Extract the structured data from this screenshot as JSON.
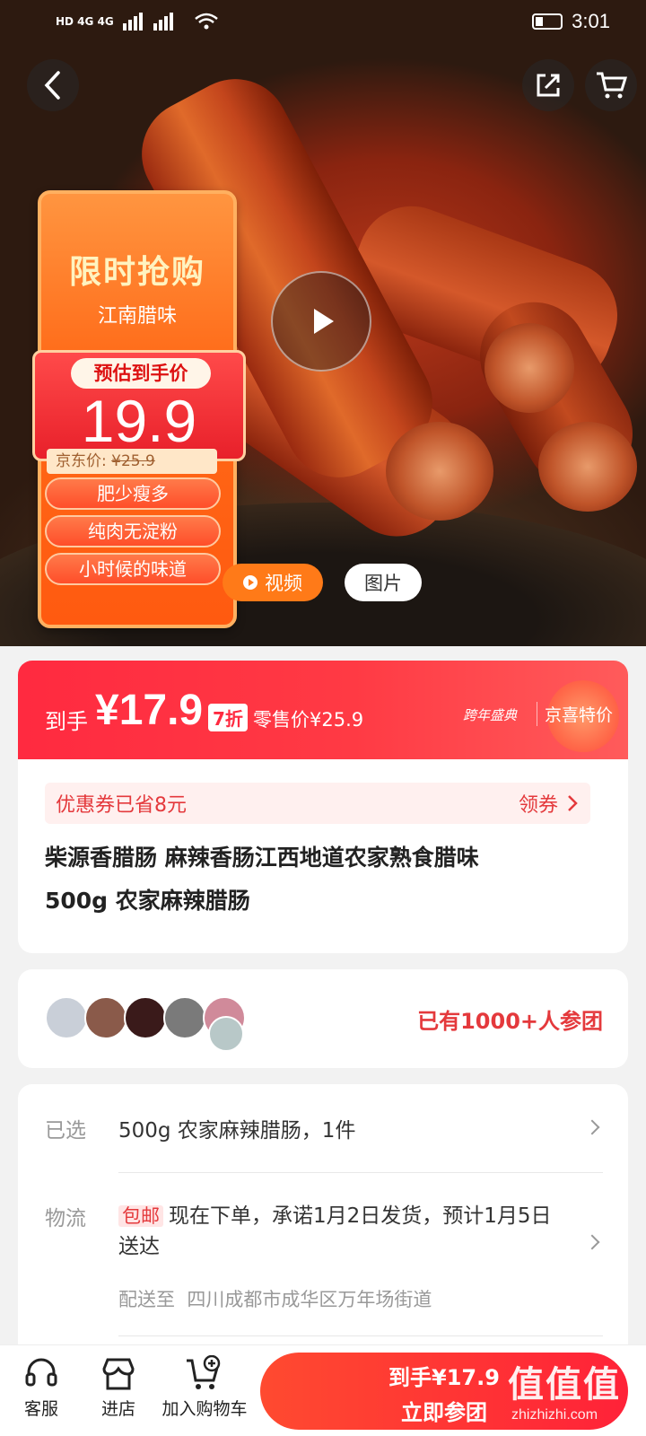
{
  "status_bar": {
    "time": "3:01",
    "network_left": "HD 4G 4G"
  },
  "hero": {
    "promo_title": "限时抢购",
    "promo_sub": "江南腊味",
    "estimated_label": "预估到手价",
    "estimated_price": "19.9",
    "jd_price_label": "京东价:",
    "jd_price_value": "¥25.9",
    "tags": [
      "肥少瘦多",
      "纯肉无淀粉",
      "小时候的味道"
    ],
    "video_label": "视频",
    "image_label": "图片"
  },
  "price_banner": {
    "prefix": "到手",
    "price": "¥17.9",
    "discount": "7折",
    "retail": "零售价¥25.9",
    "event": "跨年盛典",
    "special": "京喜特价"
  },
  "coupon": {
    "text": "优惠券已省8元",
    "action": "领券"
  },
  "product": {
    "title_line1": "柴源香腊肠 麻辣香肠江西地道农家熟食腊味",
    "title_line2": "500g 农家麻辣腊肠"
  },
  "group": {
    "text": "已有1000+人参团",
    "avatar_colors": [
      "#c9cfd8",
      "#8a5a4a",
      "#3a1a1a",
      "#7a7a7a",
      "#d08a9a",
      "#b8c8c8"
    ]
  },
  "options": {
    "selected_label": "已选",
    "selected_value": "500g 农家麻辣腊肠，1件",
    "logistics_label": "物流",
    "free_shipping": "包邮",
    "logistics_text": "现在下单，承诺1月2日发货，预计1月5日送达",
    "ship_to_label": "配送至",
    "ship_to_address": "四川成都市成华区万年场街道"
  },
  "bottom_bar": {
    "service_label": "客服",
    "store_label": "进店",
    "cart_label": "加入购物车",
    "buy_price": "到手¥17.9",
    "buy_label": "立即参团"
  },
  "watermark": {
    "main": "值值值",
    "sub": "zhizhizhi.com"
  },
  "colors": {
    "accent_red": "#e4393c",
    "promo_orange": "#ff6a18"
  },
  "icons": [
    "back-icon",
    "share-icon",
    "cart-icon",
    "play-icon",
    "headset-icon",
    "store-icon",
    "add-cart-icon",
    "chevron-right-icon"
  ]
}
